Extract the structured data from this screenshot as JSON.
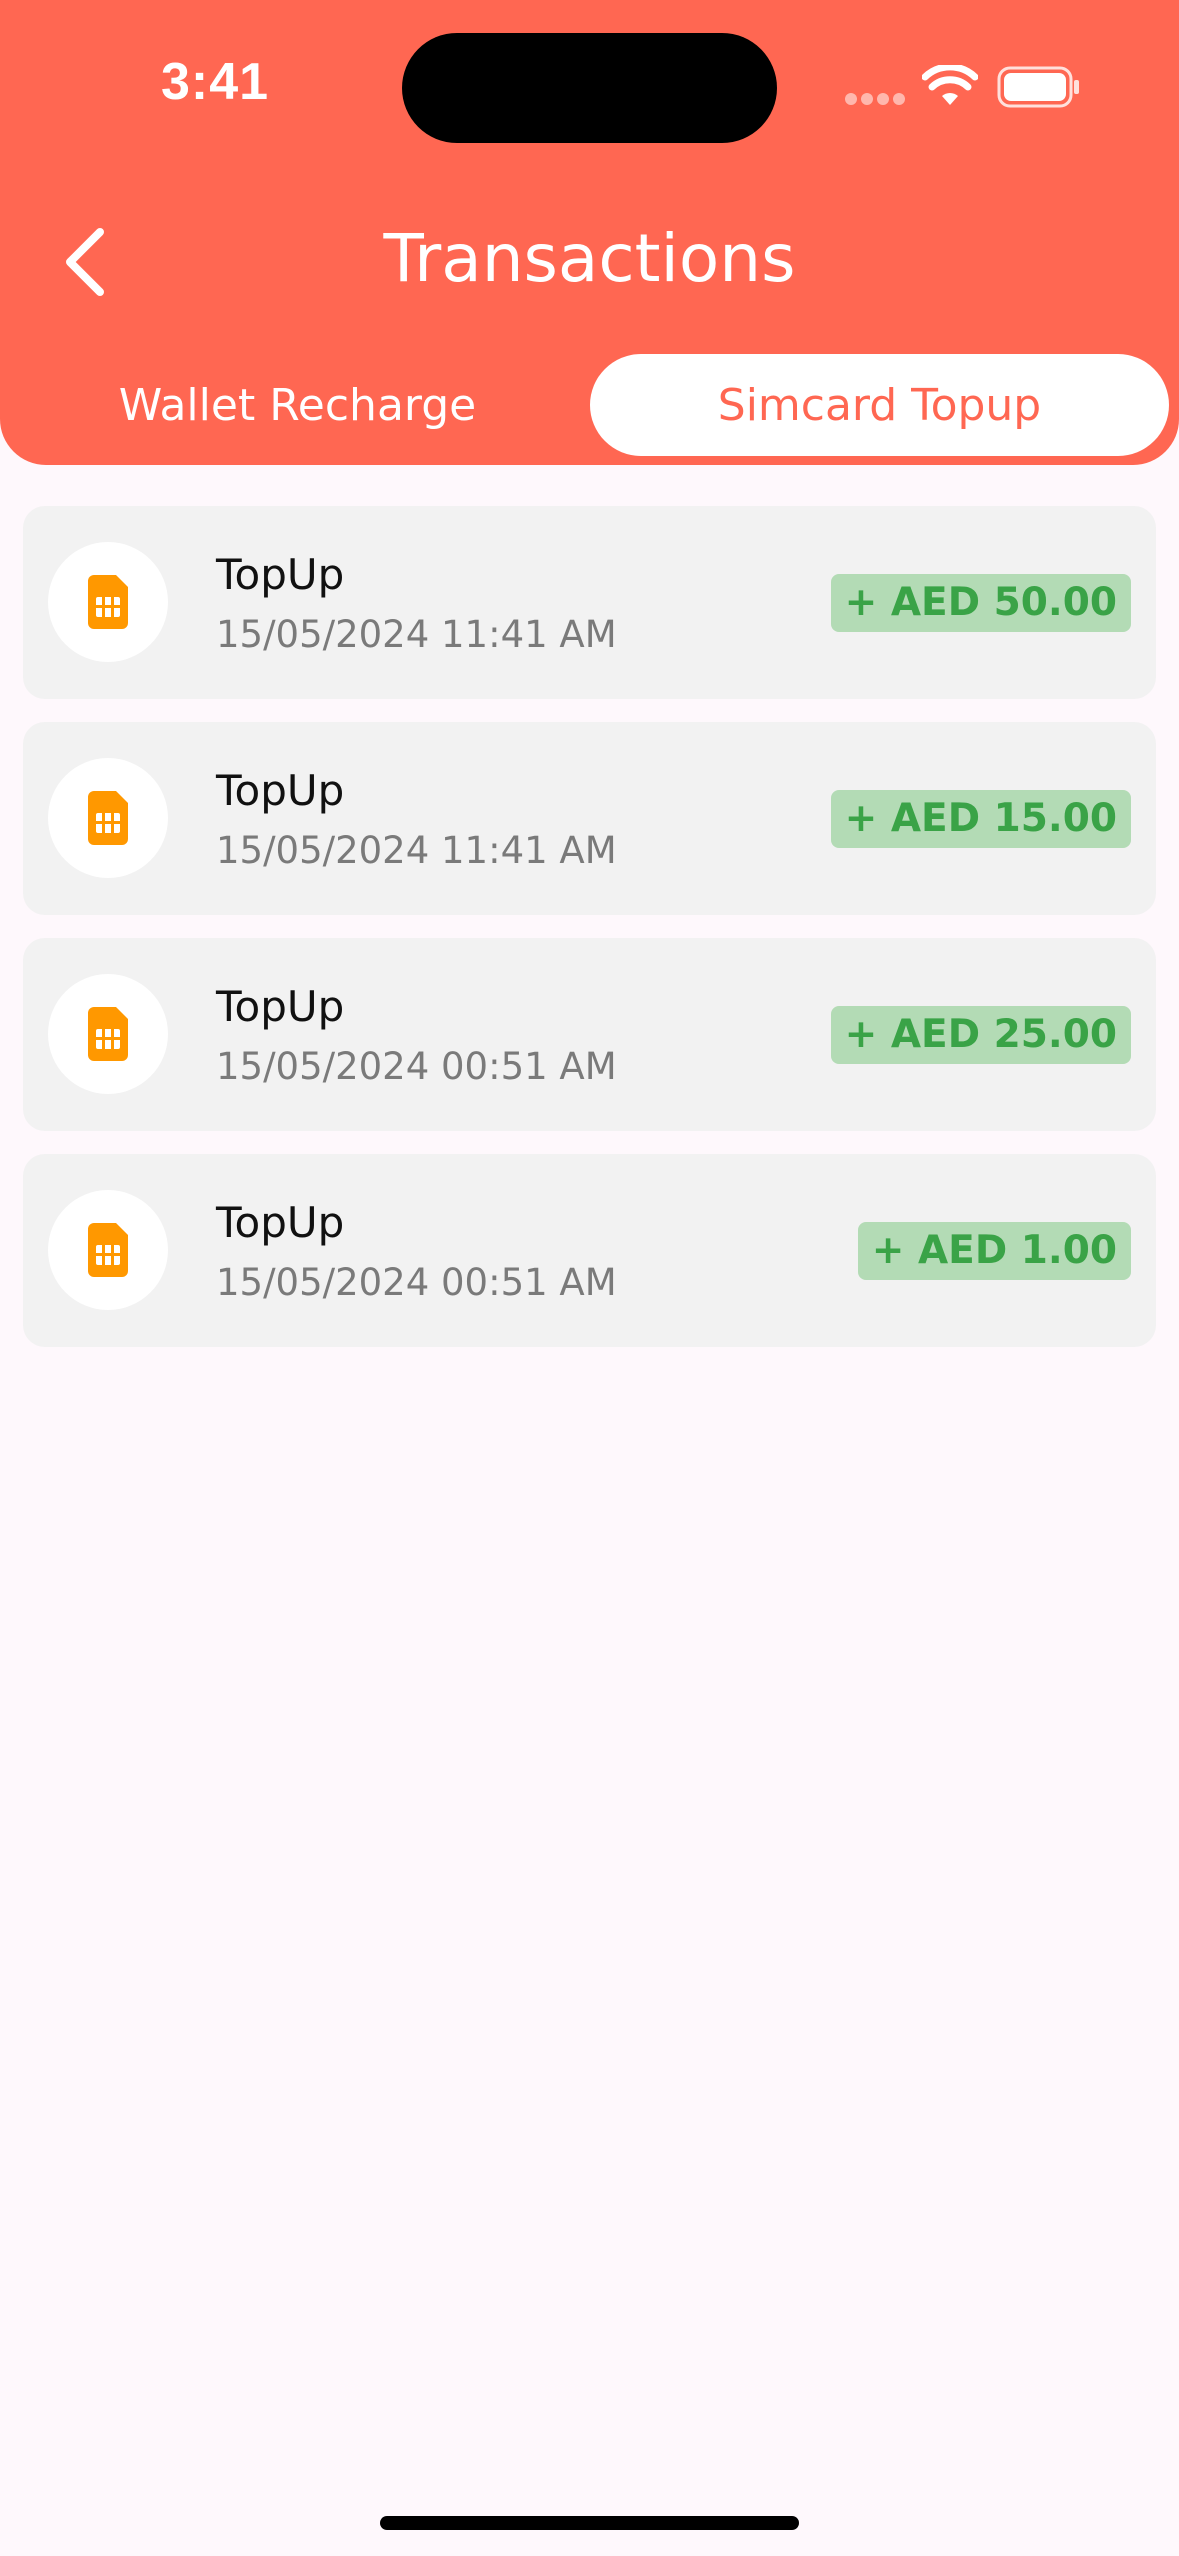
{
  "status_bar": {
    "time": "3:41"
  },
  "header": {
    "title": "Transactions"
  },
  "tabs": [
    {
      "label": "Wallet Recharge",
      "active": false
    },
    {
      "label": "Simcard Topup",
      "active": true
    }
  ],
  "transactions": [
    {
      "title": "TopUp",
      "date": "15/05/2024 11:41 AM",
      "amount": "+ AED 50.00",
      "icon": "sim-card-icon"
    },
    {
      "title": "TopUp",
      "date": "15/05/2024 11:41 AM",
      "amount": "+ AED 15.00",
      "icon": "sim-card-icon"
    },
    {
      "title": "TopUp",
      "date": "15/05/2024 00:51 AM",
      "amount": "+ AED 25.00",
      "icon": "sim-card-icon"
    },
    {
      "title": "TopUp",
      "date": "15/05/2024 00:51 AM",
      "amount": "+ AED 1.00",
      "icon": "sim-card-icon"
    }
  ],
  "colors": {
    "brand": "#ff6752",
    "icon_accent": "#ff9800",
    "amount_text": "#3aa347",
    "amount_bg": "#b3dbb5",
    "card_bg": "#f2f2f2",
    "page_bg": "#fef8fc"
  }
}
